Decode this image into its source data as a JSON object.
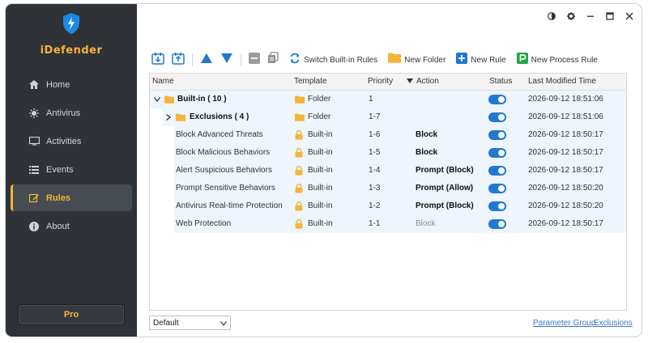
{
  "app": {
    "name": "iDefender"
  },
  "colors": {
    "sidebar_bg": "#2f3338",
    "accent": "#f5b43b",
    "toggle_on": "#1f78d1",
    "link": "#3a76c8",
    "row_highlight": "#eef5fc"
  },
  "sidebar": {
    "items": [
      {
        "label": "Home",
        "icon": "home-icon"
      },
      {
        "label": "Antivirus",
        "icon": "virus-icon"
      },
      {
        "label": "Activities",
        "icon": "monitor-icon"
      },
      {
        "label": "Events",
        "icon": "list-icon"
      },
      {
        "label": "Rules",
        "icon": "edit-icon",
        "active": true
      },
      {
        "label": "About",
        "icon": "info-icon"
      }
    ],
    "pro_label": "Pro"
  },
  "window_controls": [
    "theme-icon",
    "settings-icon",
    "minimize-icon",
    "maximize-icon",
    "close-icon"
  ],
  "toolbar": {
    "switch_label": "Switch Built-in Rules",
    "new_folder_label": "New Folder",
    "new_rule_label": "New Rule",
    "new_process_rule_label": "New Process Rule"
  },
  "table": {
    "columns": {
      "name": "Name",
      "template": "Template",
      "priority": "Priority",
      "action": "Action",
      "status": "Status",
      "modified": "Last Modified Time"
    },
    "rows": [
      {
        "name": "Built-in ( 10 )",
        "template": "Folder",
        "priority": "1",
        "action": "",
        "status": true,
        "modified": "2026-09-12 18:51:06"
      },
      {
        "name": "Exclusions ( 4 )",
        "template": "Folder",
        "priority": "1-7",
        "action": "",
        "status": true,
        "modified": "2026-09-12 18:51:06"
      },
      {
        "name": "Block Advanced Threats",
        "template": "Built-in",
        "priority": "1-6",
        "action": "Block",
        "status": true,
        "modified": "2026-09-12 18:50:17"
      },
      {
        "name": "Block Malicious Behaviors",
        "template": "Built-in",
        "priority": "1-5",
        "action": "Block",
        "status": true,
        "modified": "2026-09-12 18:50:17"
      },
      {
        "name": "Alert Suspicious Behaviors",
        "template": "Built-in",
        "priority": "1-4",
        "action": "Prompt (Block)",
        "status": true,
        "modified": "2026-09-12 18:50:17"
      },
      {
        "name": "Prompt Sensitive Behaviors",
        "template": "Built-in",
        "priority": "1-3",
        "action": "Prompt (Allow)",
        "status": true,
        "modified": "2026-09-12 18:50:20"
      },
      {
        "name": "Antivirus Real-time Protection",
        "template": "Built-in",
        "priority": "1-2",
        "action": "Prompt (Block)",
        "status": true,
        "modified": "2026-09-12 18:50:20"
      },
      {
        "name": "Web Protection",
        "template": "Built-in",
        "priority": "1-1",
        "action": "Block",
        "status": true,
        "modified": "2026-09-12 18:50:17"
      }
    ]
  },
  "footer": {
    "group_select": "Default",
    "parameter_group_link": "Parameter Group",
    "exclusions_link": "Exclusions"
  }
}
